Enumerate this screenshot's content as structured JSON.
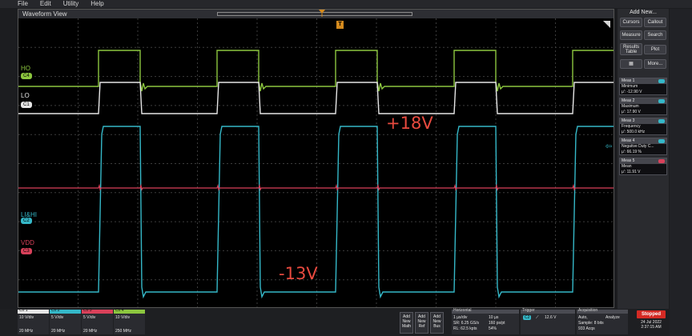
{
  "menu": [
    "File",
    "Edit",
    "Utility",
    "Help"
  ],
  "waveform_view": {
    "title": "Waveform View",
    "trigger_marker": "T",
    "annotations": [
      "+18V",
      "-13V"
    ]
  },
  "channels_on_screen": [
    {
      "name": "HO",
      "badge": "C4",
      "color": "#8cc63f"
    },
    {
      "name": "LO",
      "badge": "C1",
      "color": "#e6e6e6"
    },
    {
      "name": "LI&HI",
      "badge": "C2",
      "color": "#35b8c8"
    },
    {
      "name": "VDD",
      "badge": "C3",
      "color": "#d9415a"
    }
  ],
  "right_panel": {
    "title": "Add New...",
    "buttons": [
      "Cursors",
      "Callout",
      "Measure",
      "Search",
      "Results Table",
      "Plot",
      "More..."
    ],
    "measurements": [
      {
        "name": "Meas 1",
        "label": "Minimum",
        "value": "µ': -12.90 V",
        "color": "#35b8c8"
      },
      {
        "name": "Meas 2",
        "label": "Maximum",
        "value": "µ': 17.90 V",
        "color": "#35b8c8"
      },
      {
        "name": "Meas 3",
        "label": "Frequency",
        "value": "µ': 500.0 kHz",
        "color": "#35b8c8"
      },
      {
        "name": "Meas 4",
        "label": "Negative Duty C...",
        "value": "µ': 66.19 %",
        "color": "#35b8c8"
      },
      {
        "name": "Meas 5",
        "label": "Mean",
        "value": "µ': 11.91 V",
        "color": "#d9415a"
      }
    ]
  },
  "bottom": {
    "channels": [
      {
        "title": "Ch 1",
        "scale": "10 V/div",
        "bw": "20 MHz",
        "color": "#e6e6e6"
      },
      {
        "title": "Ch 2",
        "scale": "5 V/div",
        "bw": "20 MHz",
        "color": "#35b8c8"
      },
      {
        "title": "Ch 3",
        "scale": "5 V/div",
        "bw": "20 MHz",
        "color": "#d9415a"
      },
      {
        "title": "Ch 4",
        "scale": "10 V/div",
        "bw": "250 MHz",
        "color": "#8cc63f"
      }
    ],
    "add_buttons": [
      "Add New Math",
      "Add New Ref",
      "Add New Bus"
    ],
    "horizontal": {
      "title": "Horizontal",
      "scale": "1 µs/div",
      "sample_rate": "SR: 6.25 GS/s",
      "record_length": "RL: 62.5 kpts",
      "delay": "10 µs",
      "resolution": "160 ps/pt",
      "position": "54%"
    },
    "trigger": {
      "title": "Trigger",
      "channel": "C2",
      "level": "12.6 V"
    },
    "acquisition": {
      "title": "Acquisition",
      "mode": "Auto,",
      "analyze": "Analyze",
      "sample": "Sample: 8 bits",
      "acqs": "933 Acqs"
    },
    "status": "Stopped",
    "date": "24 Jul 2022",
    "time": "2:37:15 AM"
  }
}
